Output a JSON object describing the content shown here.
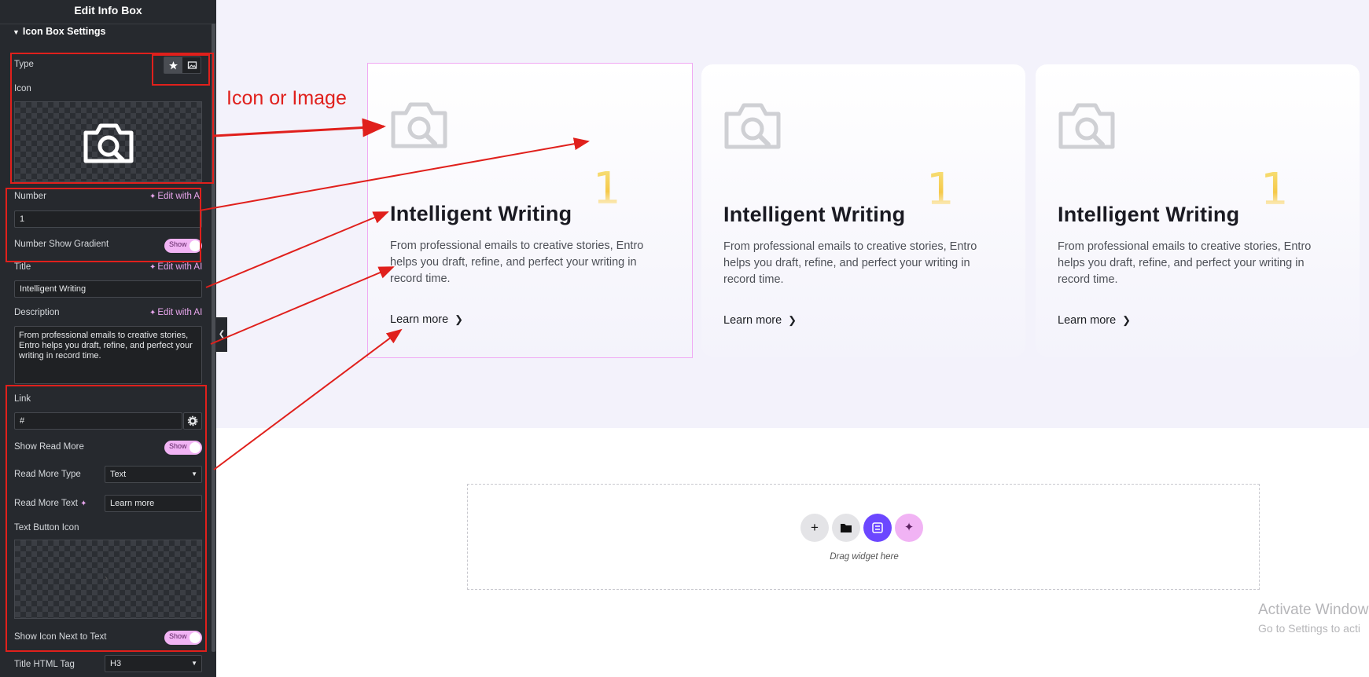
{
  "sidebar": {
    "header": "Edit Info Box",
    "section_title": "Icon Box Settings",
    "type_label": "Type",
    "icon_label": "Icon",
    "number_label": "Number",
    "edit_ai_number": "Edit with A",
    "number_value": "1",
    "number_gradient_label": "Number Show Gradient",
    "toggle_show": "Show",
    "title_label": "Title",
    "edit_ai_title": "Edit with AI",
    "title_value": "Intelligent Writing",
    "description_label": "Description",
    "edit_ai_description": "Edit with AI",
    "description_value": "From professional emails to creative stories, Entro helps you draft, refine, and perfect your writing in record time.",
    "link_label": "Link",
    "link_value": "#",
    "show_read_more_label": "Show Read More",
    "read_more_type_label": "Read More Type",
    "read_more_type_value": "Text",
    "read_more_text_label": "Read More Text",
    "read_more_text_value": "Learn more",
    "text_button_icon_label": "Text Button Icon",
    "show_icon_next_label": "Show Icon Next to Text",
    "title_html_tag_label": "Title HTML Tag",
    "title_html_tag_value": "H3"
  },
  "annotation": {
    "label": "Icon or Image",
    "color": "#e0201c"
  },
  "cards": [
    {
      "number": "1",
      "title": "Intelligent Writing",
      "description": "From professional emails to creative stories, Entro helps you draft, refine, and perfect your writing in record time.",
      "link_text": "Learn more"
    },
    {
      "number": "1",
      "title": "Intelligent Writing",
      "description": "From professional emails to creative stories, Entro helps you draft, refine, and perfect your writing in record time.",
      "link_text": "Learn more"
    },
    {
      "number": "1",
      "title": "Intelligent Writing",
      "description": "From professional emails to creative stories, Entro helps you draft, refine, and perfect your writing in record time.",
      "link_text": "Learn more"
    }
  ],
  "drop_zone": {
    "text": "Drag widget here",
    "buttons": [
      "plus-icon",
      "folder-icon",
      "elementor-kit-icon",
      "ai-sparkle-icon"
    ]
  },
  "watermark": {
    "line1": "Activate Window",
    "line2": "Go to Settings to acti"
  },
  "colors": {
    "panel_bg": "#26292e",
    "accent_pink": "#f1b3f4",
    "hero_bg": "#f3f2fb",
    "number_gold": "#f5c94a",
    "kit_purple": "#6c47ff"
  }
}
